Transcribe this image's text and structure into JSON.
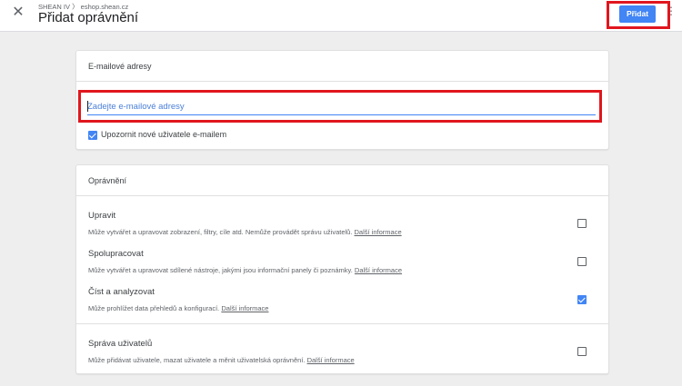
{
  "header": {
    "breadcrumb": "SHEAN IV 〉 eshop.shean.cz",
    "title": "Přidat oprávnění",
    "add_button_label": "Přidat",
    "close_icon": "close-icon",
    "more_icon": "more-vert-icon"
  },
  "emails_card": {
    "title": "E-mailové adresy",
    "input_placeholder": "Zadejte e-mailové adresy",
    "input_value": "",
    "notify_label": "Upozornit nové uživatele e-mailem",
    "notify_checked": true
  },
  "permissions_card": {
    "title": "Oprávnění",
    "items": [
      {
        "title": "Upravit",
        "description": "Může vytvářet a upravovat zobrazení, filtry, cíle atd. Nemůže provádět správu uživatelů.",
        "link": "Další informace",
        "checked": false
      },
      {
        "title": "Spolupracovat",
        "description": "Může vytvářet a upravovat sdílené nástroje, jakými jsou informační panely či poznámky.",
        "link": "Další informace",
        "checked": false
      },
      {
        "title": "Číst a analyzovat",
        "description": "Může prohlížet data přehledů a konfigurací.",
        "link": "Další informace",
        "checked": true
      },
      {
        "title": "Správa uživatelů",
        "description": "Může přidávat uživatele, mazat uživatele a měnit uživatelská oprávnění.",
        "link": "Další informace",
        "checked": false
      }
    ]
  },
  "colors": {
    "accent": "#4285f4",
    "highlight": "#e0161e",
    "background": "#eeeeee"
  }
}
